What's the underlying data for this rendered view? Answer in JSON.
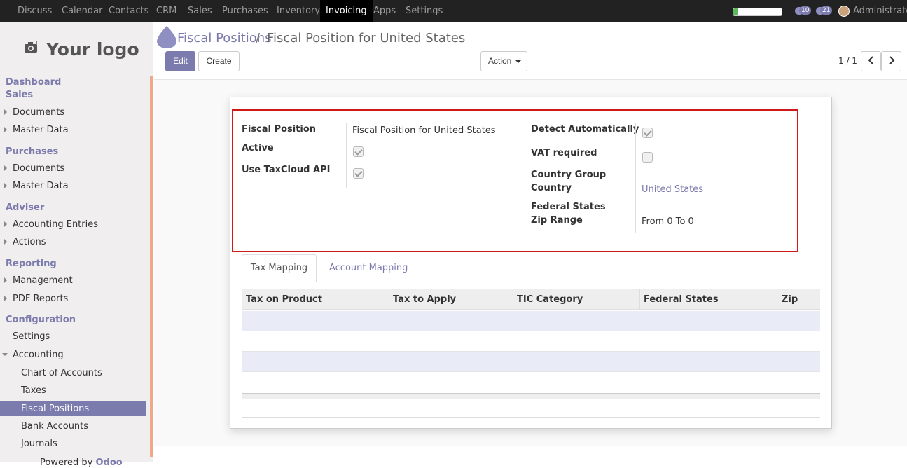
{
  "topbar": {
    "menus": [
      "Discuss",
      "Calendar",
      "Contacts",
      "CRM",
      "Sales",
      "Purchases",
      "Inventory",
      "Invoicing",
      "Apps",
      "Settings"
    ],
    "active_menu": "Invoicing",
    "progress": 0.1,
    "messages_badge": "10",
    "chat_badge": "21",
    "user": "Administrator"
  },
  "sidebar": {
    "logo_text": "Your logo",
    "sections": {
      "dashboard": "Dashboard",
      "sales": "Sales",
      "sales_documents": "Documents",
      "sales_master": "Master Data",
      "purchases": "Purchases",
      "purchases_documents": "Documents",
      "purchases_master": "Master Data",
      "adviser": "Adviser",
      "accounting_entries": "Accounting Entries",
      "actions": "Actions",
      "reporting": "Reporting",
      "management": "Management",
      "pdf_reports": "PDF Reports",
      "configuration": "Configuration",
      "settings": "Settings",
      "accounting": "Accounting",
      "chart_of_accounts": "Chart of Accounts",
      "taxes": "Taxes",
      "fiscal_positions": "Fiscal Positions",
      "bank_accounts": "Bank Accounts",
      "journals": "Journals"
    },
    "powered_by": "Powered by",
    "powered_brand": "Odoo"
  },
  "breadcrumb": {
    "parent": "Fiscal Positions",
    "separator": "/",
    "current": "Fiscal Position for United States"
  },
  "buttons": {
    "edit": "Edit",
    "create": "Create",
    "action": "Action"
  },
  "pager": "1 / 1",
  "form": {
    "fiscal_position_label": "Fiscal Position",
    "fiscal_position_value": "Fiscal Position for United States",
    "active_label": "Active",
    "active_checked": true,
    "taxcloud_label": "Use TaxCloud API",
    "taxcloud_checked": true,
    "detect_label": "Detect Automatically",
    "detect_checked": true,
    "vat_label": "VAT required",
    "vat_checked": false,
    "country_group_label": "Country Group",
    "country_label": "Country",
    "country_value": "United States",
    "federal_states_label": "Federal States",
    "zip_label": "Zip Range",
    "zip_value": "From 0 To 0"
  },
  "tabs": [
    "Tax Mapping",
    "Account Mapping"
  ],
  "table": {
    "columns": [
      "Tax on Product",
      "Tax to Apply",
      "TIC Category",
      "Federal States",
      "Zip"
    ]
  }
}
